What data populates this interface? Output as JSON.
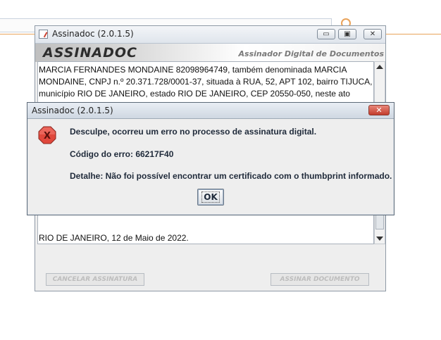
{
  "main_window": {
    "title": "Assinadoc (2.0.1.5)",
    "logo_text": "ASSINADOC",
    "tagline": "Assinador Digital de Documentos",
    "document_lines": [
      "MARCIA FERNANDES MONDAINE 82098964749, também denominada MARCIA",
      "MONDAINE, CNPJ n.º 20.371.728/0001-37, situada à RUA, 52, APT 102, bairro TIJUCA,",
      "município RIO DE JANEIRO, estado RIO DE JANEIRO, CEP 20550-050, neste ato"
    ],
    "document_footer": "RIO DE JANEIRO, 12 de Maio de 2022.",
    "cancel_button": "CANCELAR ASSINATURA",
    "sign_button": "ASSINAR DOCUMENTO",
    "window_buttons": {
      "minimize": "▭",
      "maximize": "▣",
      "close": "✕"
    }
  },
  "error_dialog": {
    "title": "Assinadoc (2.0.1.5)",
    "close_glyph": "✕",
    "message": "Desculpe, ocorreu um erro no processo de assinatura digital.",
    "error_code": "Código do erro: 66217F40",
    "detail": "Detalhe: Não foi possível encontrar um certificado com o thumbprint informado.",
    "ok_label": "OK",
    "icon": "error-icon",
    "colors": {
      "icon_fill": "#e0483c",
      "close_button": "#c94a3a"
    }
  }
}
